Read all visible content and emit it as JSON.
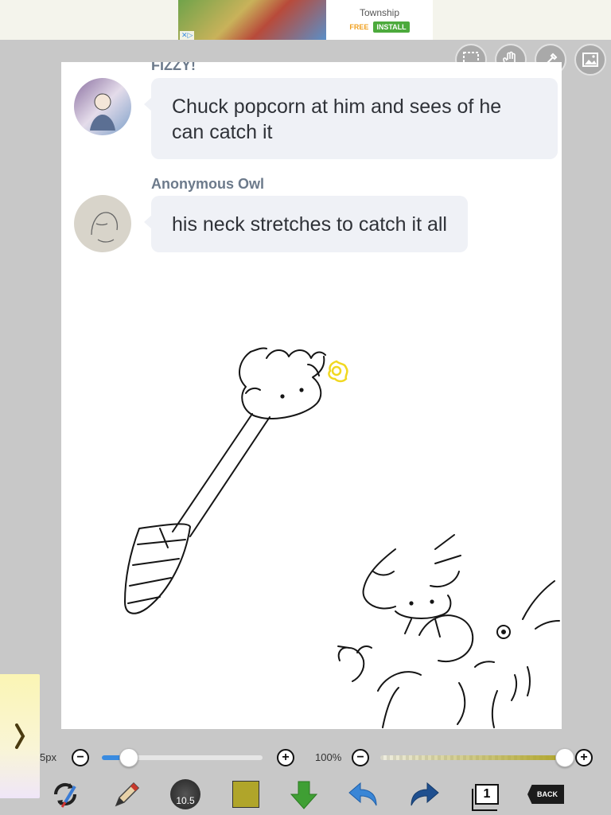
{
  "ad": {
    "title": "Township",
    "free_label": "FREE",
    "install_label": "INSTALL"
  },
  "top_tools": [
    {
      "name": "selection-icon"
    },
    {
      "name": "hand-icon"
    },
    {
      "name": "eyedropper-icon"
    },
    {
      "name": "image-icon"
    }
  ],
  "chat": {
    "messages": [
      {
        "author": "FIZZY!",
        "text": "Chuck popcorn at him and sees of he can catch it"
      },
      {
        "author": "Anonymous Owl",
        "text": "his neck stretches to catch it all"
      }
    ]
  },
  "sliders": {
    "brush_size_label": "5px",
    "brush_size_fraction": 0.17,
    "zoom_label": "100%",
    "opacity_fraction": 1.0
  },
  "toolbar": {
    "brush_size_value": "10.5",
    "current_color": "#b0a52a",
    "layer_count": "1",
    "back_label": "BACK"
  },
  "colors": {
    "background": "#c8c8c8",
    "slider_blue": "#3a8be0",
    "opacity_olive": "#b0a52a"
  }
}
